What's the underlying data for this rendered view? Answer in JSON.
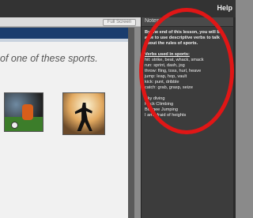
{
  "topbar": {
    "help_label": "Help"
  },
  "toolbar": {
    "fullscreen_label": "Full Screen"
  },
  "slide": {
    "text": "of one of these sports."
  },
  "notes": {
    "title": "Notes",
    "intro": "By the end of this lesson, you will be able to use descriptive verbs to talk about the rules of sports.",
    "heading": "Verbs used in sports:",
    "verb_lines": [
      "hit: strike, beat, whack, smack",
      "run: sprint, dash, jog",
      "throw: fling, toss, hurl, heave",
      "jump: leap, hop, vault",
      "kick: punt, dribble",
      "catch: grab, grasp, seize"
    ],
    "sports": [
      "Sky diving",
      "Rock Climbing",
      "Bungee Jumping",
      "I am afraid of heights"
    ]
  },
  "colors": {
    "annotation": "#e01616",
    "header": "#1a3d6e"
  }
}
